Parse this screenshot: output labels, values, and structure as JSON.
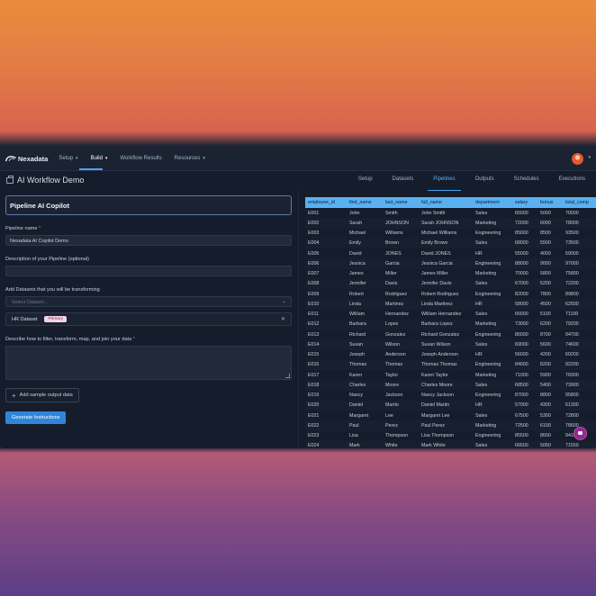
{
  "nav": {
    "logo": "Nexadata",
    "items": [
      {
        "label": "Setup",
        "dropdown": true
      },
      {
        "label": "Build",
        "dropdown": true,
        "active": true
      },
      {
        "label": "Workflow Results",
        "dropdown": false
      },
      {
        "label": "Resources",
        "dropdown": true
      }
    ]
  },
  "header": {
    "title": "AI Workflow Demo",
    "tabs": [
      "Setup",
      "Datasets",
      "Pipelines",
      "Outputs",
      "Schedules",
      "Executions"
    ],
    "active_tab": "Pipelines"
  },
  "form": {
    "copilot_title": "Pipeline AI Copilot",
    "pipeline_name_label": "Pipeline name",
    "required_mark": "*",
    "pipeline_name_value": "Nexadata AI Copilot Demo",
    "description_label": "Description of your Pipeline (optional)",
    "description_value": "",
    "datasets_label": "Add Datasets that you will be transforming",
    "datasets_placeholder": "Select Dataset...",
    "selected_dataset": "HR Dataset",
    "selected_dataset_badge": "Primary",
    "instructions_label": "Describe how to filter, transform, map, and join your data",
    "add_sample_output": "Add sample output data",
    "generate_button": "Generate Instructions"
  },
  "table": {
    "columns": [
      "employee_id",
      "first_name",
      "last_name",
      "full_name",
      "department",
      "salary",
      "bonus",
      "total_comp"
    ],
    "rows": [
      [
        "E001",
        "John",
        "Smith",
        "John Smith",
        "Sales",
        "65000",
        "5000",
        "70000"
      ],
      [
        "E002",
        "Sarah",
        "JOHNSON",
        "Sarah JOHNSON",
        "Marketing",
        "72000",
        "6000",
        "78000"
      ],
      [
        "E003",
        "Michael",
        "Williams",
        "Michael Williams",
        "Engineering",
        "85000",
        "8500",
        "93500"
      ],
      [
        "E004",
        "Emily",
        "Brown",
        "Emily Brown",
        "Sales",
        "68000",
        "5500",
        "73500"
      ],
      [
        "E005",
        "David",
        "JONES",
        "David JONES",
        "HR",
        "55000",
        "4000",
        "59000"
      ],
      [
        "E006",
        "Jessica",
        "Garcia",
        "Jessica Garcia",
        "Engineering",
        "88000",
        "9000",
        "97000"
      ],
      [
        "E007",
        "James",
        "Miller",
        "James Miller",
        "Marketing",
        "70000",
        "5800",
        "75800"
      ],
      [
        "E008",
        "Jennifer",
        "Davis",
        "Jennifer Davis",
        "Sales",
        "67000",
        "5200",
        "72200"
      ],
      [
        "E009",
        "Robert",
        "Rodriguez",
        "Robert Rodriguez",
        "Engineering",
        "82000",
        "7800",
        "89800"
      ],
      [
        "E010",
        "Linda",
        "Martinez",
        "Linda Martinez",
        "HR",
        "58000",
        "4500",
        "62500"
      ],
      [
        "E011",
        "William",
        "Hernandez",
        "William Hernandez",
        "Sales",
        "66000",
        "5100",
        "71100"
      ],
      [
        "E012",
        "Barbara",
        "Lopez",
        "Barbara Lopez",
        "Marketing",
        "73000",
        "6200",
        "79200"
      ],
      [
        "E013",
        "Richard",
        "Gonzalez",
        "Richard Gonzalez",
        "Engineering",
        "86000",
        "8700",
        "94700"
      ],
      [
        "E014",
        "Susan",
        "Wilson",
        "Susan Wilson",
        "Sales",
        "69000",
        "5600",
        "74600"
      ],
      [
        "E015",
        "Joseph",
        "Anderson",
        "Joseph Anderson",
        "HR",
        "56000",
        "4200",
        "60200"
      ],
      [
        "E016",
        "Thomas",
        "Thomas",
        "Thomas Thomas",
        "Engineering",
        "84000",
        "8200",
        "92200"
      ],
      [
        "E017",
        "Karen",
        "Taylor",
        "Karen Taylor",
        "Marketing",
        "71000",
        "5900",
        "76900"
      ],
      [
        "E018",
        "Charles",
        "Moore",
        "Charles Moore",
        "Sales",
        "68500",
        "5400",
        "73900"
      ],
      [
        "E019",
        "Nancy",
        "Jackson",
        "Nancy Jackson",
        "Engineering",
        "87000",
        "8800",
        "95800"
      ],
      [
        "E020",
        "Daniel",
        "Martin",
        "Daniel Martin",
        "HR",
        "57000",
        "4300",
        "61300"
      ],
      [
        "E021",
        "Margaret",
        "Lee",
        "Margaret Lee",
        "Sales",
        "67500",
        "5300",
        "72800"
      ],
      [
        "E022",
        "Paul",
        "Perez",
        "Paul Perez",
        "Marketing",
        "72500",
        "6100",
        "78600"
      ],
      [
        "E023",
        "Lisa",
        "Thompson",
        "Lisa Thompson",
        "Engineering",
        "85500",
        "8600",
        "94100"
      ],
      [
        "E024",
        "Mark",
        "White",
        "Mark White",
        "Sales",
        "66500",
        "5050",
        "71550"
      ]
    ]
  },
  "colors": {
    "accent": "#4aa3f0",
    "table_header": "#5ab1f2",
    "primary_button": "#2f86d9",
    "badge_bg": "#f3d5e3"
  }
}
